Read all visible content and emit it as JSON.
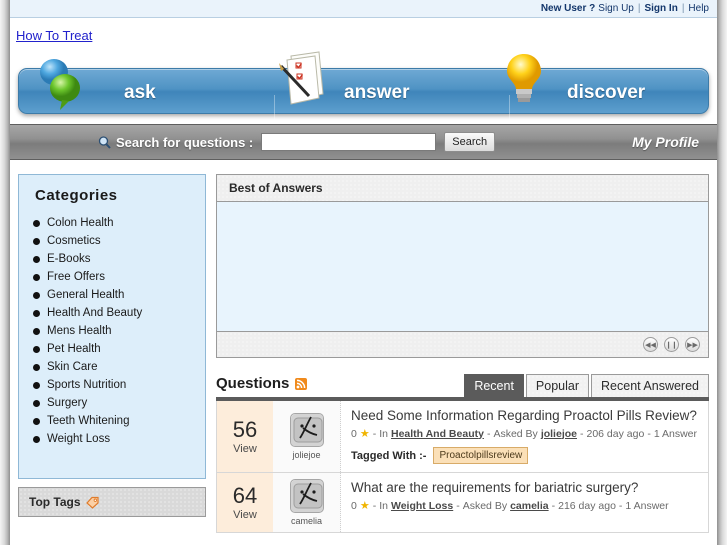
{
  "topbar": {
    "new_user": "New User ?",
    "sign_up": "Sign Up",
    "sign_in": "Sign In",
    "help": "Help",
    "separator": "|"
  },
  "logo": {
    "text": "How To Treat"
  },
  "banner": {
    "ask": "ask",
    "answer": "answer",
    "discover": "discover",
    "ask_icon": "speech-balloons-icon",
    "answer_icon": "notepad-pencil-icon",
    "discover_icon": "lightbulb-icon"
  },
  "search": {
    "label": "Search for questions :",
    "value": "",
    "placeholder": "",
    "button": "Search",
    "icon": "magnifier-icon",
    "profile": "My Profile"
  },
  "sidebar": {
    "categories_title": "Categories",
    "categories": [
      "Colon Health",
      "Cosmetics",
      "E-Books",
      "Free Offers",
      "General Health",
      "Health And Beauty",
      "Mens Health",
      "Pet Health",
      "Skin Care",
      "Sports Nutrition",
      "Surgery",
      "Teeth Whitening",
      "Weight Loss"
    ],
    "top_tags_title": "Top Tags",
    "top_tags_icon": "tag-icon"
  },
  "best_of_answers": {
    "title": "Best of Answers",
    "controls": [
      {
        "name": "rewind",
        "glyph": "◀◀"
      },
      {
        "name": "pause",
        "glyph": "❙❙"
      },
      {
        "name": "forward",
        "glyph": "▶▶"
      }
    ]
  },
  "questions": {
    "title": "Questions",
    "rss_icon": "rss-icon",
    "tabs": [
      {
        "label": "Recent",
        "active": true
      },
      {
        "label": "Popular",
        "active": false
      },
      {
        "label": "Recent Answered",
        "active": false
      }
    ],
    "tagged_with_label": "Tagged With :-",
    "items": [
      {
        "views": "56",
        "views_label": "View",
        "avatar_name": "joliejoe",
        "avatar_icon": "mac-face-avatar-icon",
        "title": "Need Some Information Regarding Proactol Pills Review?",
        "votes": "0",
        "in_label": "In",
        "category": "Health And Beauty",
        "asked_by_label": "Asked By",
        "author": "joliejoe",
        "age": "206 day ago",
        "answers": "1 Answer",
        "tags": [
          "Proactolpillsreview"
        ]
      },
      {
        "views": "64",
        "views_label": "View",
        "avatar_name": "camelia",
        "avatar_icon": "mac-face-avatar-icon",
        "title": "What are the requirements for bariatric surgery?",
        "votes": "0",
        "in_label": "In",
        "category": "Weight Loss",
        "asked_by_label": "Asked By",
        "author": "camelia",
        "age": "216 day ago",
        "answers": "1 Answer",
        "tags": []
      }
    ]
  }
}
